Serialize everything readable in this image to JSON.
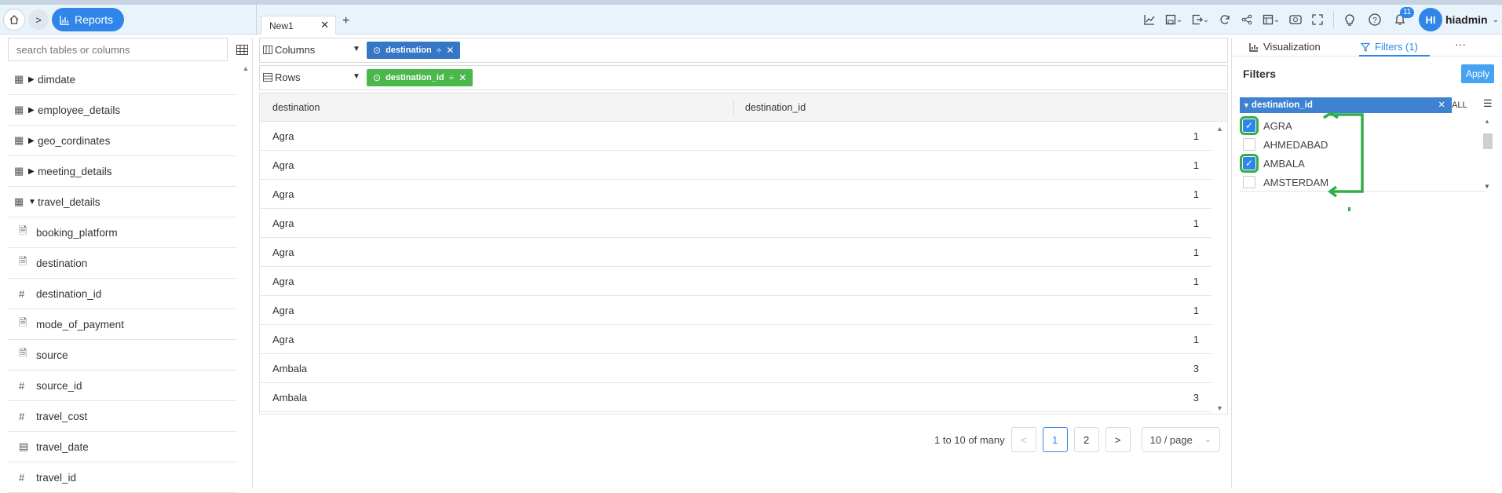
{
  "header": {
    "home_icon": "home-icon",
    "breadcrumb_chevron": ">",
    "reports_label": "Reports",
    "tab_label": "New1",
    "notifications_count": "11",
    "avatar_initials": "HI",
    "username": "hiadmin"
  },
  "sidebar": {
    "search_placeholder": "search tables or columns",
    "tables": [
      {
        "label": "dimdate",
        "expanded": false
      },
      {
        "label": "employee_details",
        "expanded": false
      },
      {
        "label": "geo_cordinates",
        "expanded": false
      },
      {
        "label": "meeting_details",
        "expanded": false
      },
      {
        "label": "travel_details",
        "expanded": true
      }
    ],
    "columns": [
      {
        "label": "booking_platform",
        "type": "text"
      },
      {
        "label": "destination",
        "type": "text"
      },
      {
        "label": "destination_id",
        "type": "number"
      },
      {
        "label": "mode_of_payment",
        "type": "text"
      },
      {
        "label": "source",
        "type": "text"
      },
      {
        "label": "source_id",
        "type": "number"
      },
      {
        "label": "travel_cost",
        "type": "number"
      },
      {
        "label": "travel_date",
        "type": "date"
      },
      {
        "label": "travel_id",
        "type": "number"
      }
    ]
  },
  "shelves": {
    "columns_label": "Columns",
    "columns_chip": "destination",
    "rows_label": "Rows",
    "rows_chip": "destination_id"
  },
  "grid": {
    "headers": [
      "destination",
      "destination_id"
    ],
    "rows": [
      [
        "Agra",
        "1"
      ],
      [
        "Agra",
        "1"
      ],
      [
        "Agra",
        "1"
      ],
      [
        "Agra",
        "1"
      ],
      [
        "Agra",
        "1"
      ],
      [
        "Agra",
        "1"
      ],
      [
        "Agra",
        "1"
      ],
      [
        "Agra",
        "1"
      ],
      [
        "Ambala",
        "3"
      ],
      [
        "Ambala",
        "3"
      ]
    ]
  },
  "pager": {
    "summary": "1 to 10 of many",
    "prev": "<",
    "pages": [
      "1",
      "2"
    ],
    "current_page": "1",
    "next": ">",
    "page_size": "10 / page"
  },
  "right_panel": {
    "tab_visualization": "Visualization",
    "tab_filters": "Filters (1)",
    "more": "···",
    "filters_title": "Filters",
    "apply_label": "Apply",
    "filter_field": "destination_id",
    "all_label": "ALL",
    "options": [
      {
        "label": "AGRA",
        "checked": true
      },
      {
        "label": "AHMEDABAD",
        "checked": false
      },
      {
        "label": "AMBALA",
        "checked": true
      },
      {
        "label": "AMSTERDAM",
        "checked": false
      }
    ]
  },
  "colors": {
    "accent": "#2f86e8",
    "chip_blue": "#3576c5",
    "chip_green": "#4bb84b",
    "annotation_green": "#2fae4a"
  }
}
